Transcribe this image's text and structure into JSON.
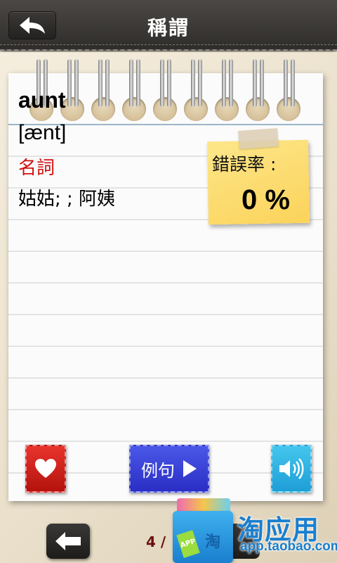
{
  "header": {
    "title": "稱謂",
    "back_icon": "back-arrow-icon"
  },
  "card": {
    "word": "aunt",
    "phonetic": "[ænt]",
    "part_of_speech": "名詞",
    "meaning": "姑姑; ; 阿姨"
  },
  "error_note": {
    "label": "錯誤率 :",
    "value": "0 %"
  },
  "actions": {
    "favorite_icon": "heart-icon",
    "example_label": "例句",
    "example_icon": "play-icon",
    "sound_icon": "speaker-icon"
  },
  "pager": {
    "text": "4 /"
  },
  "overlay": {
    "brand": "淘应用",
    "url": "app.taobao.com",
    "bag_char": "淘",
    "bag_tag": "APP"
  },
  "colors": {
    "accent_red": "#d01010",
    "sticky": "#fbd35a",
    "fav": "#c9201a",
    "example": "#3a40d8",
    "sound": "#2eb2e2"
  }
}
